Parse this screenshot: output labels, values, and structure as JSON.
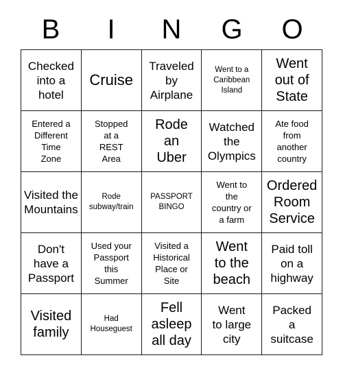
{
  "header": {
    "letters": [
      "B",
      "I",
      "N",
      "G",
      "O"
    ]
  },
  "grid": {
    "rows": [
      [
        {
          "text": "Checked\ninto a\nhotel",
          "size": "md"
        },
        {
          "text": "Cruise",
          "size": "xl"
        },
        {
          "text": "Traveled\nby\nAirplane",
          "size": "md"
        },
        {
          "text": "Went to a\nCaribbean\nIsland",
          "size": "xs"
        },
        {
          "text": "Went\nout of\nState",
          "size": "lg"
        }
      ],
      [
        {
          "text": "Entered a\nDifferent\nTime\nZone",
          "size": "sm"
        },
        {
          "text": "Stopped\nat a\nREST\nArea",
          "size": "sm"
        },
        {
          "text": "Rode\nan\nUber",
          "size": "lg"
        },
        {
          "text": "Watched\nthe\nOlympics",
          "size": "md"
        },
        {
          "text": "Ate food\nfrom\nanother\ncountry",
          "size": "sm"
        }
      ],
      [
        {
          "text": "Visited the\nMountains",
          "size": "md"
        },
        {
          "text": "Rode\nsubway/train",
          "size": "xs"
        },
        {
          "text": "PASSPORT\nBINGO",
          "size": "xs"
        },
        {
          "text": "Went to\nthe\ncountry or\na farm",
          "size": "sm"
        },
        {
          "text": "Ordered\nRoom\nService",
          "size": "lg"
        }
      ],
      [
        {
          "text": "Don't\nhave a\nPassport",
          "size": "md"
        },
        {
          "text": "Used your\nPassport\nthis\nSummer",
          "size": "sm"
        },
        {
          "text": "Visited a\nHistorical\nPlace or\nSite",
          "size": "sm"
        },
        {
          "text": "Went\nto the\nbeach",
          "size": "lg"
        },
        {
          "text": "Paid toll\non a\nhighway",
          "size": "md"
        }
      ],
      [
        {
          "text": "Visited\nfamily",
          "size": "lg"
        },
        {
          "text": "Had\nHouseguest",
          "size": "xs"
        },
        {
          "text": "Fell\nasleep\nall day",
          "size": "lg"
        },
        {
          "text": "Went\nto large\ncity",
          "size": "md"
        },
        {
          "text": "Packed\na\nsuitcase",
          "size": "md"
        }
      ]
    ]
  }
}
